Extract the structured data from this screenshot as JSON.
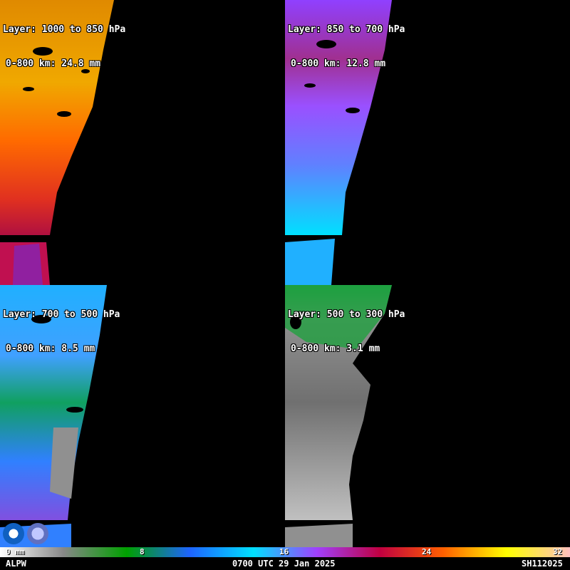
{
  "panels": [
    {
      "layer": "Layer: 1000 to 850 hPa",
      "value": "0-800 km: 24.8 mm"
    },
    {
      "layer": "Layer: 850 to 700 hPa",
      "value": "0-800 km: 12.8 mm"
    },
    {
      "layer": "Layer: 700 to 500 hPa",
      "value": "0-800 km: 8.5 mm"
    },
    {
      "layer": "Layer: 500 to 300 hPa",
      "value": "0-800 km: 3.1 mm"
    }
  ],
  "colorbar": {
    "ticks": [
      "0 mm",
      "8",
      "16",
      "24",
      "32"
    ],
    "colors": [
      "#ffffff",
      "#888888",
      "#00a000",
      "#1e64ff",
      "#00e0ff",
      "#a040ff",
      "#c00040",
      "#ff6000",
      "#ffff00",
      "#ffc0c0"
    ]
  },
  "footer": {
    "product": "ALPW",
    "time": "0700 UTC 29 Jan 2025",
    "code": "SH112025"
  },
  "logos": [
    "noaa-logo",
    "cira-logo"
  ]
}
